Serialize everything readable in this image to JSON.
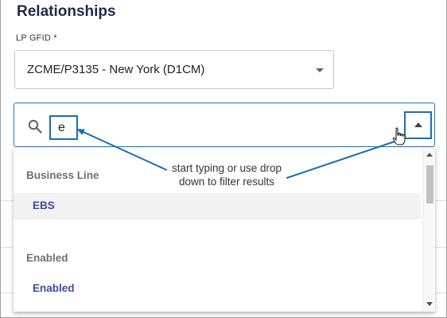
{
  "panel": {
    "title": "Relationships"
  },
  "lp_gfid": {
    "label": "LP GFID *",
    "selected_value": "ZCME/P3135 - New York (D1CM)"
  },
  "search": {
    "value": "e"
  },
  "dropdown": {
    "groups": [
      {
        "header": "Business Line",
        "options": [
          {
            "label": "EBS"
          }
        ]
      },
      {
        "header": "Enabled",
        "options": [
          {
            "label": "Enabled"
          }
        ]
      }
    ]
  },
  "annotation": {
    "text": "start typing or use drop down to filter results"
  },
  "colors": {
    "accent": "#1a7bbd",
    "annotation_arrow": "#1a6fae",
    "option_text": "#3b4aa5",
    "group_header": "#707070"
  }
}
